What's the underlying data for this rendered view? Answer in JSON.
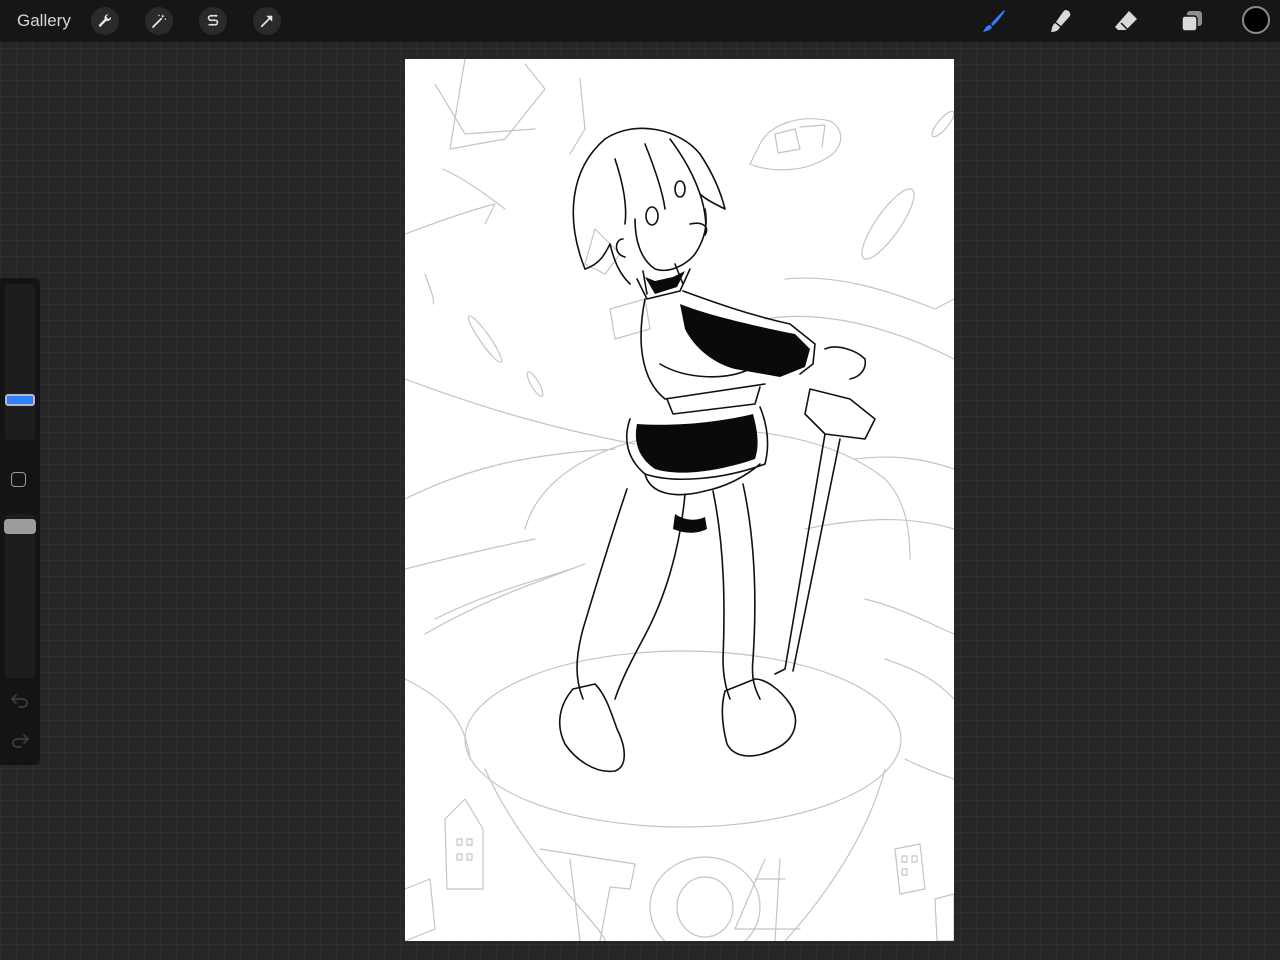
{
  "topbar": {
    "gallery_label": "Gallery",
    "left_tools": [
      {
        "name": "actions",
        "icon": "wrench-icon"
      },
      {
        "name": "adjustments",
        "icon": "magic-wand-icon"
      },
      {
        "name": "selection",
        "icon": "selection-s-icon"
      },
      {
        "name": "transform",
        "icon": "arrow-cursor-icon"
      }
    ],
    "right_tools": [
      {
        "name": "brush",
        "icon": "brush-icon",
        "active": true
      },
      {
        "name": "smudge",
        "icon": "smudge-icon",
        "active": false
      },
      {
        "name": "eraser",
        "icon": "eraser-icon",
        "active": false
      },
      {
        "name": "layers",
        "icon": "layers-icon",
        "active": false
      }
    ],
    "current_color": "#000000"
  },
  "sidebar": {
    "brush_size_level": 0.28,
    "opacity_level": 1.0,
    "accent_color": "#2f7fff"
  },
  "canvas": {
    "background": "#ffffff",
    "artwork": "line-art"
  }
}
